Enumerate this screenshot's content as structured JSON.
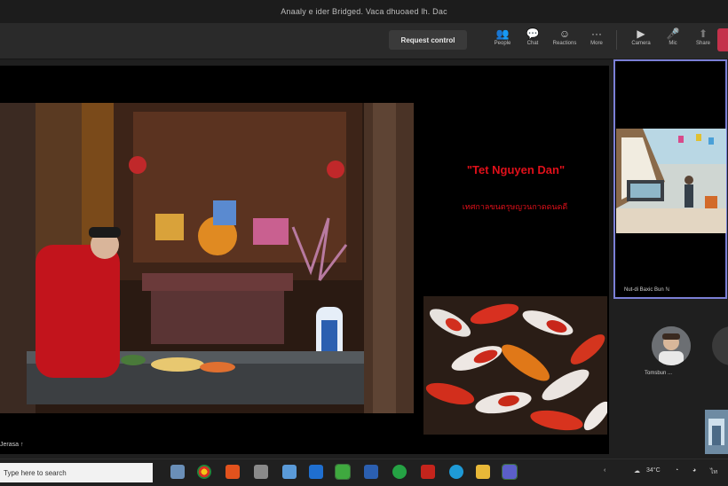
{
  "window": {
    "title": "Anaaly e ider Bridged. Vaca dhuoaed lh. Dac"
  },
  "toolbar": {
    "request_control_label": "Request control",
    "tools": [
      {
        "name": "people",
        "icon": "people-icon",
        "label": "People"
      },
      {
        "name": "chat",
        "icon": "chat-icon",
        "label": "Chat"
      },
      {
        "name": "reactions",
        "icon": "reactions-icon",
        "label": "Reactions"
      },
      {
        "name": "more",
        "icon": "more-icon",
        "label": "More"
      },
      {
        "name": "camera",
        "icon": "camera-icon",
        "label": "Camera"
      },
      {
        "name": "mic",
        "icon": "mic-icon",
        "label": "Mic"
      },
      {
        "name": "share",
        "icon": "share-icon",
        "label": "Share"
      }
    ]
  },
  "slide": {
    "title": "\"Tet Nguyen Dan\"",
    "subtitle": "เทศกาลขนตรุษญวนกาดดนดดี"
  },
  "presenter": {
    "label": "Jerasa ↑"
  },
  "participants": {
    "main_tile_name": "Nut-di Baxic Bun   ℕ",
    "avatar_name": "Tomsbun ..."
  },
  "taskbar": {
    "search_placeholder": "Type here to search",
    "temperature": "34°C",
    "icons": [
      "file-explorer-icon",
      "chrome-icon",
      "office-icon",
      "store-icon",
      "pinned-app-icon",
      "windows-icon",
      "line-icon",
      "word-icon",
      "whatsapp-icon",
      "app-red-icon",
      "edge-icon",
      "folder-icon",
      "teams-icon"
    ]
  },
  "colors": {
    "accent": "#7b7fd6",
    "slide_text": "#e0101a",
    "hangup": "#c4314b"
  }
}
